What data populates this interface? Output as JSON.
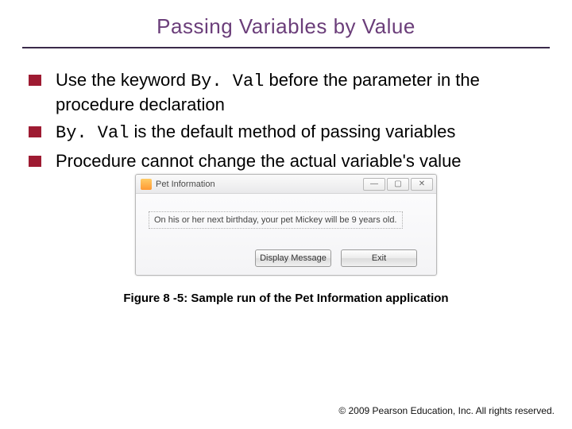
{
  "title": "Passing Variables by Value",
  "bullets": [
    {
      "pre": "Use the keyword ",
      "code": "By. Val",
      "post": " before the parameter in the procedure declaration"
    },
    {
      "pre": "",
      "code": "By. Val",
      "post": " is the default method of passing variables"
    },
    {
      "pre": "Procedure cannot change the actual variable's value",
      "code": "",
      "post": ""
    }
  ],
  "dialog": {
    "title": "Pet Information",
    "message": "On his or her next birthday, your pet Mickey will be 9 years old.",
    "buttons": {
      "display": "Display Message",
      "exit": "Exit"
    },
    "controls": {
      "min": "—",
      "max": "▢",
      "close": "✕"
    }
  },
  "caption": "Figure 8 -5: Sample run of the Pet Information application",
  "footer": "© 2009 Pearson Education, Inc.  All rights reserved."
}
